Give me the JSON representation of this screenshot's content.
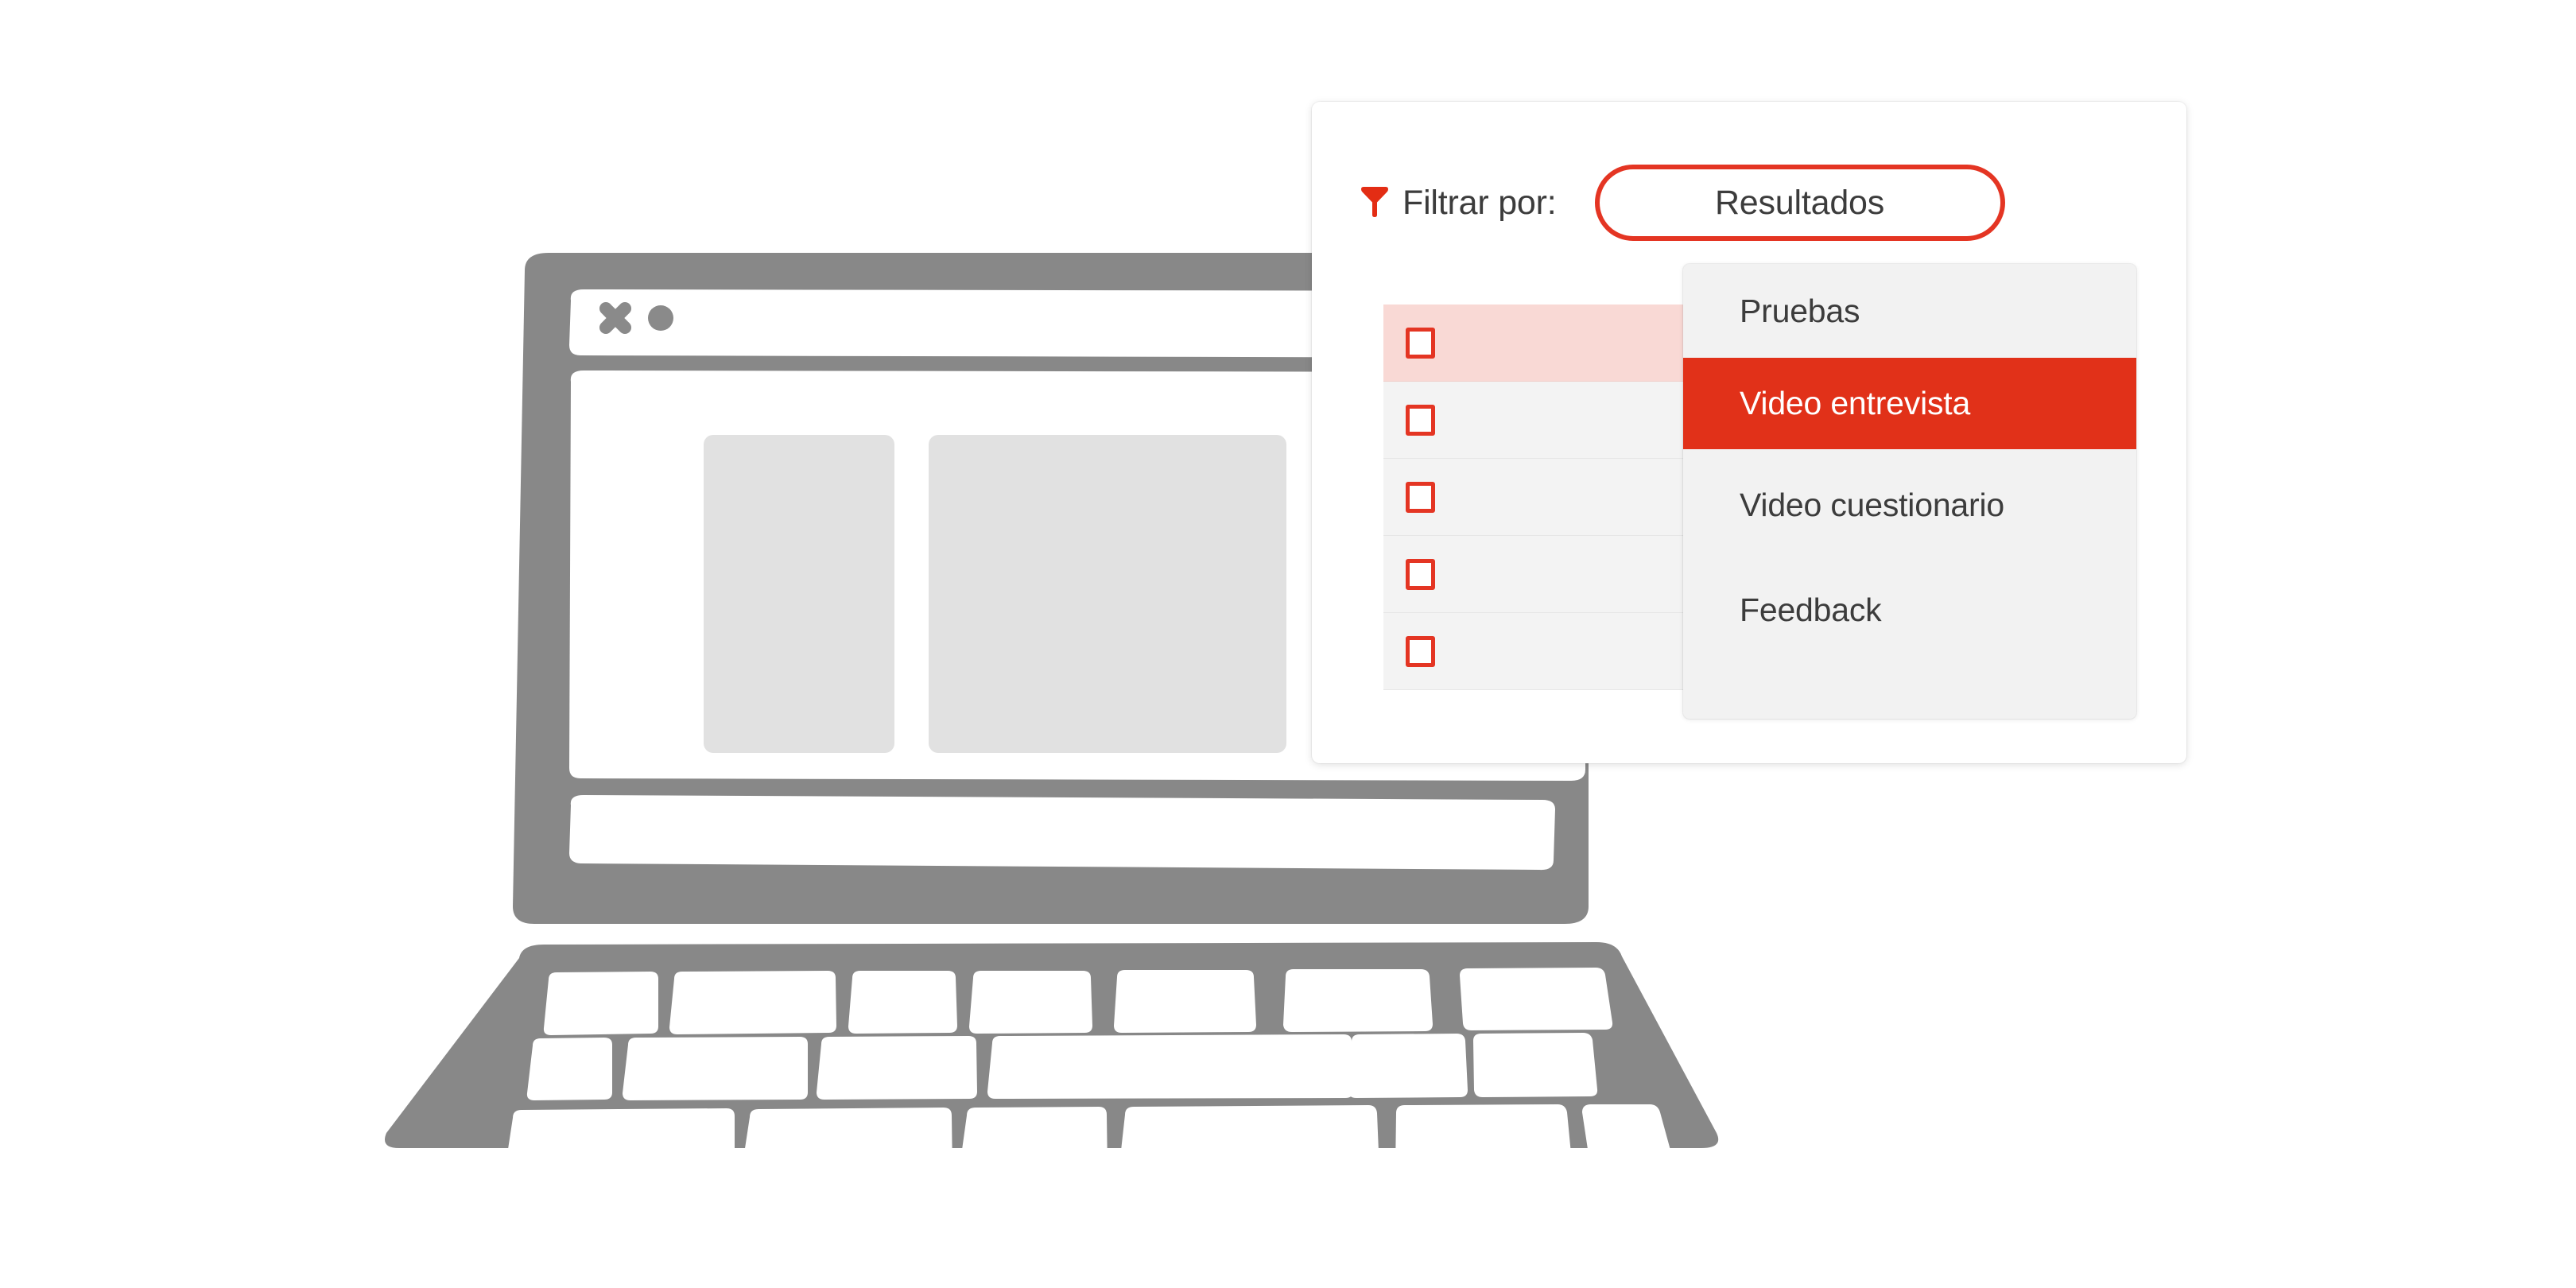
{
  "illustration": {
    "name": "laptop-with-browser-window",
    "body_color": "#888888",
    "screen_color": "#ffffff",
    "placeholder_color": "#e0e0e0",
    "window_controls": [
      "close-x-icon",
      "dot-icon"
    ]
  },
  "card": {
    "filter": {
      "icon": "funnel-icon",
      "icon_color": "#e32d14",
      "label": "Filtrar por:",
      "selected_value": "Resultados",
      "pill_border_color": "#e43523"
    },
    "results_table": {
      "rows": [
        {
          "checkbox": "unchecked",
          "highlighted": true
        },
        {
          "checkbox": "unchecked",
          "highlighted": false
        },
        {
          "checkbox": "unchecked",
          "highlighted": false
        },
        {
          "checkbox": "unchecked",
          "highlighted": false
        },
        {
          "checkbox": "unchecked",
          "highlighted": false
        }
      ]
    },
    "dropdown": {
      "selected_index": 1,
      "highlight_color": "#e13119",
      "background_color": "#f2f2f2",
      "items": [
        {
          "label": "Pruebas"
        },
        {
          "label": "Video entrevista"
        },
        {
          "label": "Video cuestionario"
        },
        {
          "label": "Feedback"
        }
      ]
    }
  }
}
